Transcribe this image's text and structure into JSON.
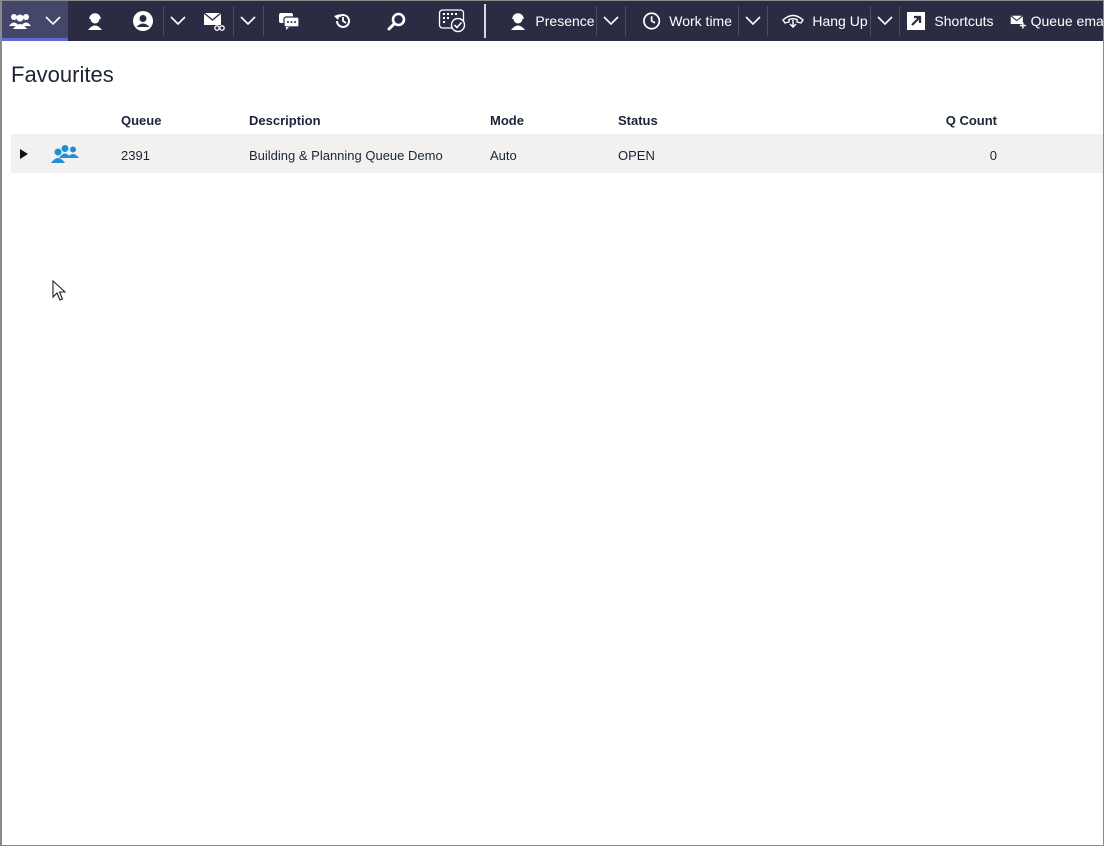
{
  "toolbar": {
    "presence_label": "Presence",
    "work_time_label": "Work time",
    "hang_up_label": "Hang Up",
    "shortcuts_label": "Shortcuts",
    "queue_email_label": "Queue email"
  },
  "page": {
    "title": "Favourites"
  },
  "table": {
    "columns": [
      "Queue",
      "Description",
      "Mode",
      "Status",
      "Q Count"
    ],
    "rows": [
      {
        "queue": "2391",
        "description": "Building & Planning Queue Demo",
        "mode": "Auto",
        "status": "OPEN",
        "q_count": "0"
      }
    ]
  },
  "colors": {
    "toolbar_bg": "#2b2c44",
    "row_bg": "#f2f1f0",
    "group_icon": "#1f8fd6"
  }
}
